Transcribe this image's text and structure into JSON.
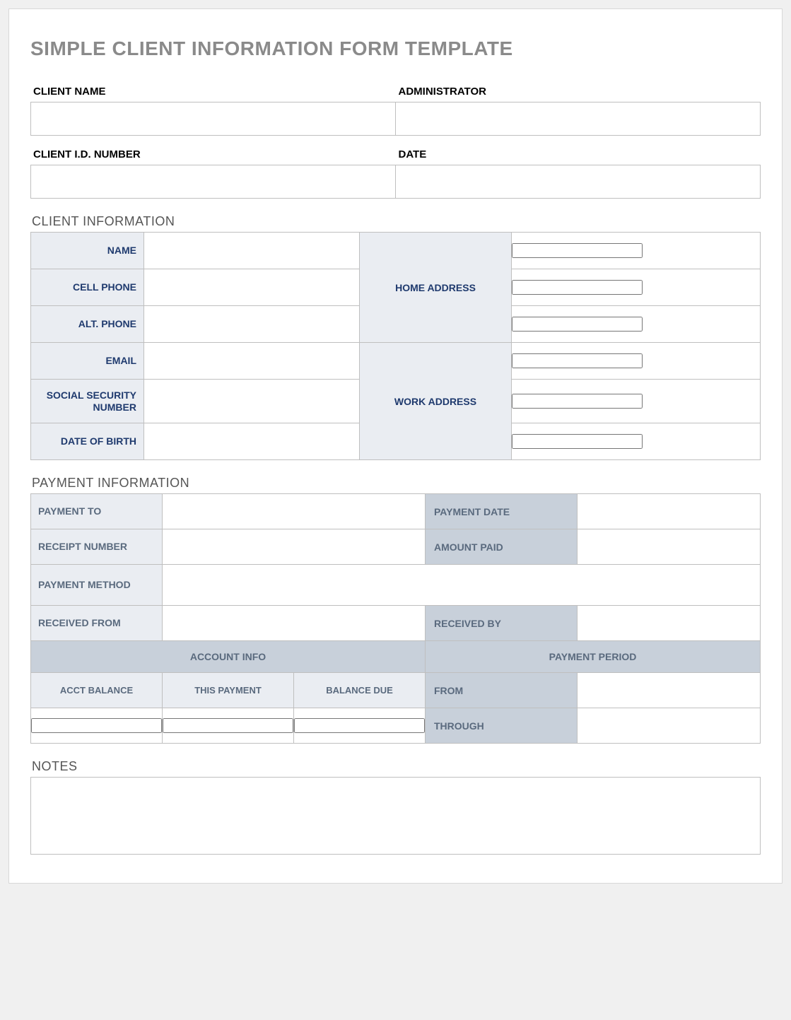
{
  "title": "SIMPLE CLIENT INFORMATION FORM TEMPLATE",
  "top": {
    "client_name_label": "CLIENT NAME",
    "administrator_label": "ADMINISTRATOR",
    "client_id_label": "CLIENT I.D. NUMBER",
    "date_label": "DATE",
    "client_name": "",
    "administrator": "",
    "client_id": "",
    "date": ""
  },
  "client_info": {
    "heading": "CLIENT INFORMATION",
    "labels": {
      "name": "NAME",
      "cell_phone": "CELL PHONE",
      "alt_phone": "ALT. PHONE",
      "email": "EMAIL",
      "ssn": "SOCIAL SECURITY NUMBER",
      "dob": "DATE OF BIRTH",
      "home_address": "HOME ADDRESS",
      "work_address": "WORK ADDRESS"
    },
    "values": {
      "name": "",
      "cell_phone": "",
      "alt_phone": "",
      "email": "",
      "ssn": "",
      "dob": "",
      "home_address_1": "",
      "home_address_2": "",
      "home_address_3": "",
      "work_address_1": "",
      "work_address_2": "",
      "work_address_3": ""
    }
  },
  "payment_info": {
    "heading": "PAYMENT INFORMATION",
    "labels": {
      "payment_to": "PAYMENT TO",
      "payment_date": "PAYMENT DATE",
      "receipt_number": "RECEIPT NUMBER",
      "amount_paid": "AMOUNT PAID",
      "payment_method": "PAYMENT METHOD",
      "received_from": "RECEIVED FROM",
      "received_by": "RECEIVED BY",
      "account_info": "ACCOUNT INFO",
      "payment_period": "PAYMENT PERIOD",
      "acct_balance": "ACCT BALANCE",
      "this_payment": "THIS PAYMENT",
      "balance_due": "BALANCE DUE",
      "from": "FROM",
      "through": "THROUGH"
    },
    "values": {
      "payment_to": "",
      "payment_date": "",
      "receipt_number": "",
      "amount_paid": "",
      "payment_method": "",
      "received_from": "",
      "received_by": "",
      "acct_balance": "",
      "this_payment": "",
      "balance_due": "",
      "from": "",
      "through": ""
    }
  },
  "notes": {
    "heading": "NOTES",
    "value": ""
  }
}
